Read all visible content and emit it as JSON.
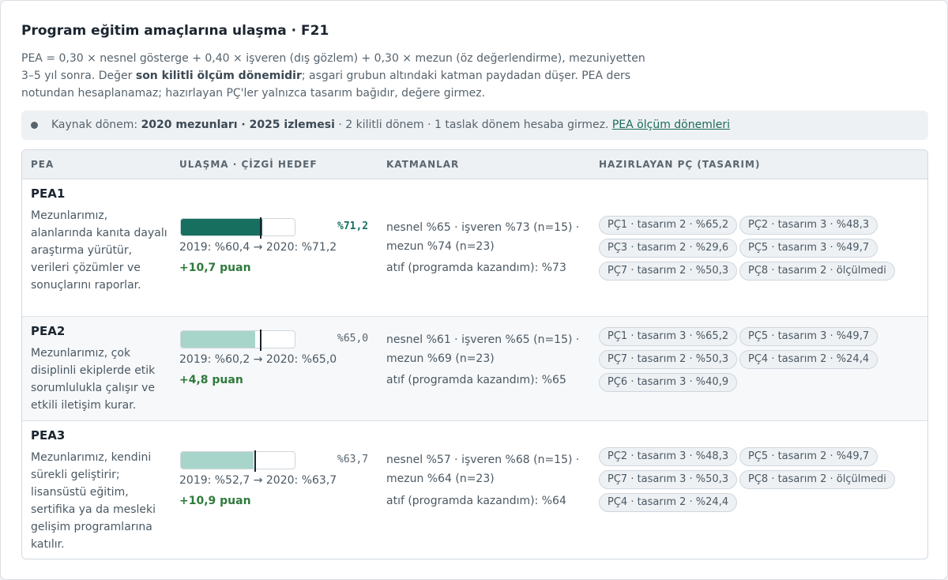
{
  "header": {
    "title": "Program eğitim amaçlarına ulaşma · F21",
    "desc_a": "PEA = 0,30 × nesnel gösterge + 0,40 × işveren (dış gözlem) + 0,30 × mezun (öz değerlendirme), mezuniyetten 3–5 yıl sonra. Değer ",
    "desc_bold": "son kilitli ölçüm dönemidir",
    "desc_b": "; asgari grubun altındaki katman paydadan düşer. PEA ders notundan hesaplanamaz; hazırlayan PÇ'ler yalnızca tasarım bağıdır, değere girmez."
  },
  "notice": {
    "prefix": "Kaynak dönem: ",
    "bold": "2020 mezunları · 2025 izlemesi",
    "rest": " · 2 kilitli dönem · 1 taslak dönem hesaba girmez. ",
    "link": "PEA ölçüm dönemleri"
  },
  "columns": [
    "PEA",
    "ULAŞMA · ÇİZGİ HEDEF",
    "KATMANLAR",
    "HAZIRLAYAN PÇ (TASARIM)"
  ],
  "colors": {
    "accent_dark": "#17705f",
    "accent_light": "#a8d5ca",
    "positive": "#2f7a3b"
  },
  "rows": [
    {
      "code": "PEA1",
      "text": "Mezunlarımız, alanlarında kanıta dayalı araştırma yürütür, verileri çözümler ve sonuçlarını raporlar.",
      "value": 71.2,
      "target": 70,
      "value_label": "%71,2",
      "highlight": true,
      "trend": "2019: %60,4 → 2020: %71,2",
      "delta": "+10,7 puan",
      "layers": "nesnel %65 · işveren %73 (n=15) · mezun %74 (n=23)",
      "atif": "atıf (programda kazandım): %73",
      "chips": [
        "PÇ1 · tasarım 2 · %65,2",
        "PÇ2 · tasarım 3 · %48,3",
        "PÇ3 · tasarım 2 · %29,6",
        "PÇ5 · tasarım 3 · %49,7",
        "PÇ7 · tasarım 2 · %50,3",
        "PÇ8 · tasarım 2 · ölçülmedi"
      ]
    },
    {
      "code": "PEA2",
      "text": "Mezunlarımız, çok disiplinli ekiplerde etik sorumlulukla çalışır ve etkili iletişim kurar.",
      "value": 65.0,
      "target": 70,
      "value_label": "%65,0",
      "highlight": false,
      "trend": "2019: %60,2 → 2020: %65,0",
      "delta": "+4,8 puan",
      "layers": "nesnel %61 · işveren %65 (n=15) · mezun %69 (n=23)",
      "atif": "atıf (programda kazandım): %65",
      "chips": [
        "PÇ1 · tasarım 3 · %65,2",
        "PÇ5 · tasarım 3 · %49,7",
        "PÇ7 · tasarım 2 · %50,3",
        "PÇ4 · tasarım 2 · %24,4",
        "PÇ6 · tasarım 3 · %40,9"
      ]
    },
    {
      "code": "PEA3",
      "text": "Mezunlarımız, kendini sürekli geliştirir; lisansüstü eğitim, sertifika ya da mesleki gelişim programlarına katılır.",
      "value": 63.7,
      "target": 65,
      "value_label": "%63,7",
      "highlight": false,
      "trend": "2019: %52,7 → 2020: %63,7",
      "delta": "+10,9 puan",
      "layers": "nesnel %57 · işveren %68 (n=15) · mezun %64 (n=23)",
      "atif": "atıf (programda kazandım): %64",
      "chips": [
        "PÇ2 · tasarım 3 · %48,3",
        "PÇ5 · tasarım 2 · %49,7",
        "PÇ7 · tasarım 3 · %50,3",
        "PÇ8 · tasarım 2 · ölçülmedi",
        "PÇ4 · tasarım 2 · %24,4"
      ]
    }
  ]
}
